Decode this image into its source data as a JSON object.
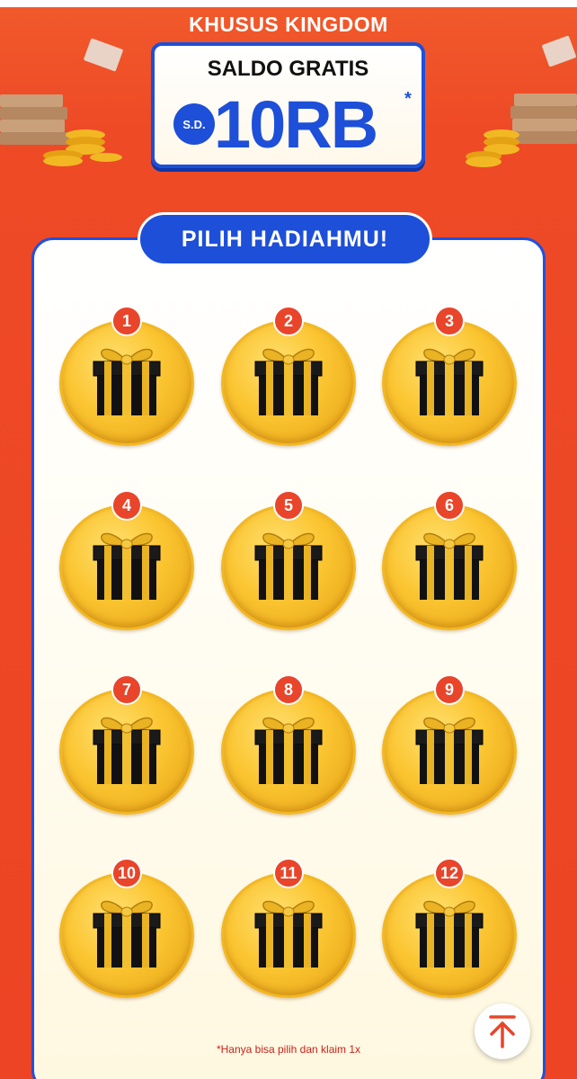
{
  "header": {
    "title": "KHUSUS KINGDOM",
    "promo_title": "SALDO GRATIS",
    "promo_prefix": "S.D.",
    "promo_amount": "10RB",
    "promo_asterisk": "*"
  },
  "section": {
    "title": "PILIH HADIAHMU!"
  },
  "gifts": [
    "1",
    "2",
    "3",
    "4",
    "5",
    "6",
    "7",
    "8",
    "9",
    "10",
    "11",
    "12"
  ],
  "footnote": "*Hanya bisa pilih dan klaim 1x",
  "icons": {
    "gift": "gift-box-icon",
    "scroll_top": "arrow-up-icon",
    "coins": "coin-stack-icon"
  },
  "colors": {
    "background": "#ec4424",
    "accent_blue": "#1d4fd8",
    "gold": "#fbc531",
    "badge_red": "#e8452a"
  }
}
